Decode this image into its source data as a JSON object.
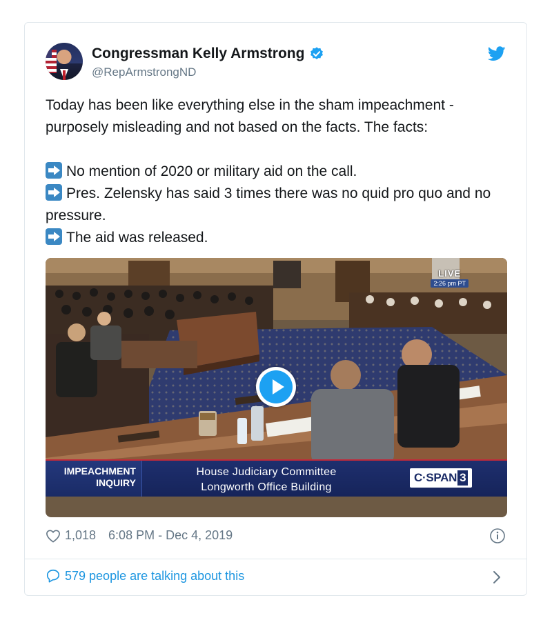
{
  "tweet": {
    "author": {
      "display_name": "Congressman Kelly Armstrong",
      "handle": "@RepArmstrongND",
      "verified": true
    },
    "text": {
      "intro": "Today has been like everything else in the sham impeachment - purposely misleading and not based on the facts. The facts:",
      "points": [
        "No mention of 2020 or military aid on the call.",
        "Pres. Zelensky has said 3 times there was no quid pro quo and no pressure.",
        "The aid was released."
      ]
    },
    "media": {
      "live_label": "LIVE",
      "live_time": "2:26 pm PT",
      "lower_third_left": "IMPEACHMENT INQUIRY",
      "lower_third_line1": "House Judiciary Committee",
      "lower_third_line2": "Longworth Office Building",
      "network_logo": "C·SPAN",
      "network_number": "3"
    },
    "likes": "1,018",
    "timestamp": "6:08 PM - Dec 4, 2019",
    "talking": "579 people are talking about this"
  },
  "icons": {
    "verified": "verified-badge-icon",
    "brand": "twitter-bird-icon",
    "like": "heart-icon",
    "info": "info-icon",
    "reply": "speech-bubble-icon",
    "more": "chevron-right-icon",
    "play": "play-icon",
    "bullet": "right-arrow-emoji-icon"
  },
  "colors": {
    "accent": "#1da1f2",
    "link": "#1b95e0",
    "muted": "#657786",
    "text": "#14171a",
    "border": "#e1e8ed"
  }
}
